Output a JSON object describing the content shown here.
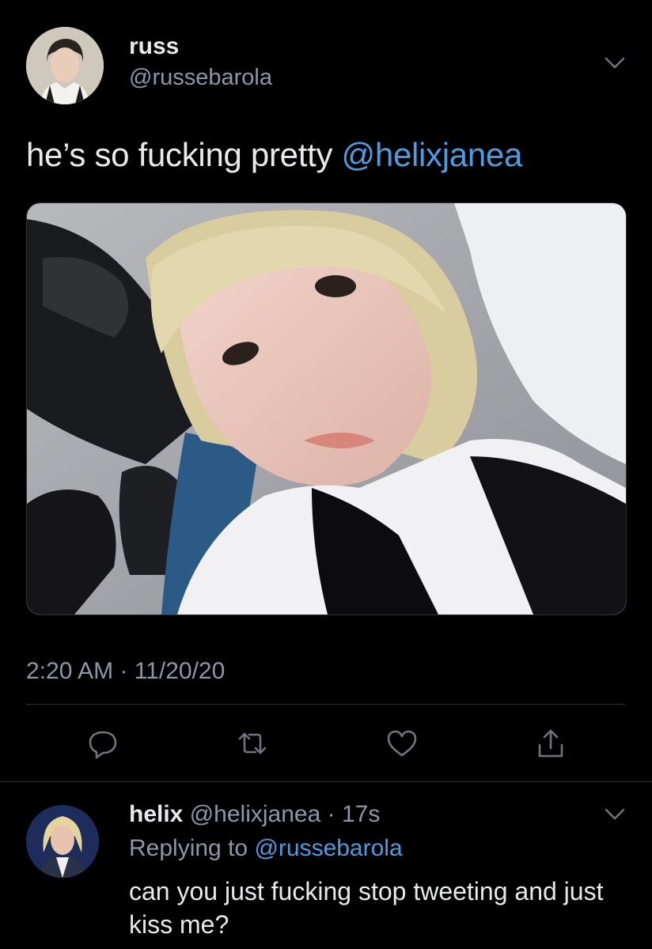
{
  "tweet": {
    "name": "russ",
    "handle": "@russebarola",
    "text": "he’s so fucking pretty ",
    "mention": "@helixjanea",
    "timestamp": "2:20 AM · 11/20/20"
  },
  "actions": [
    "reply-icon",
    "retweet-icon",
    "like-icon",
    "share-icon"
  ],
  "reply": {
    "name": "helix",
    "handle": "@helixjanea",
    "sep": " · ",
    "time": "17s",
    "replying_prefix": "Replying to ",
    "replying_handle": "@russebarola",
    "text": "can you just fucking stop tweeting and just kiss me?"
  },
  "colors": {
    "background": "#000000",
    "text": "#e7e9ea",
    "secondary": "#8b98a5",
    "link": "#4a9ce3",
    "divider": "#2f3336"
  }
}
